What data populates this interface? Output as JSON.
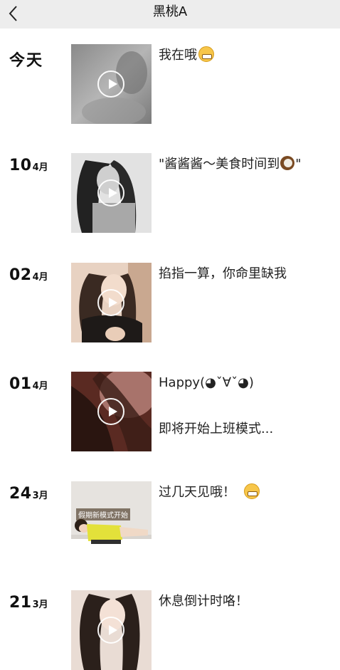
{
  "header": {
    "title": "黑桃A",
    "back_icon": "chevron-left-icon"
  },
  "posts": [
    {
      "day": "今天",
      "month": "",
      "caption": "我在哦",
      "caption_emoji": "grinning-face-icon",
      "caption2": ""
    },
    {
      "day": "10",
      "month": "4月",
      "caption": "\"酱酱酱～美食时间到",
      "caption_tail": "\"",
      "caption_emoji": "coconut-icon",
      "caption2": ""
    },
    {
      "day": "02",
      "month": "4月",
      "caption": "掐指一算，你命里缺我",
      "caption2": ""
    },
    {
      "day": "01",
      "month": "4月",
      "caption": "Happy(◕ˇ∀ˇ◕)",
      "caption2": "即将开始上班模式..."
    },
    {
      "day": "24",
      "month": "3月",
      "caption": "过几天见哦！",
      "caption_emoji": "grinning-face-icon",
      "caption2": ""
    },
    {
      "day": "21",
      "month": "3月",
      "caption": "休息倒计时咯！",
      "caption2": ""
    }
  ],
  "thumb_overlay": "假期新模式开始",
  "play_icon": "play-circle-icon",
  "colors": {
    "topbar": "#ededed",
    "emoji": "#f7c64a"
  }
}
